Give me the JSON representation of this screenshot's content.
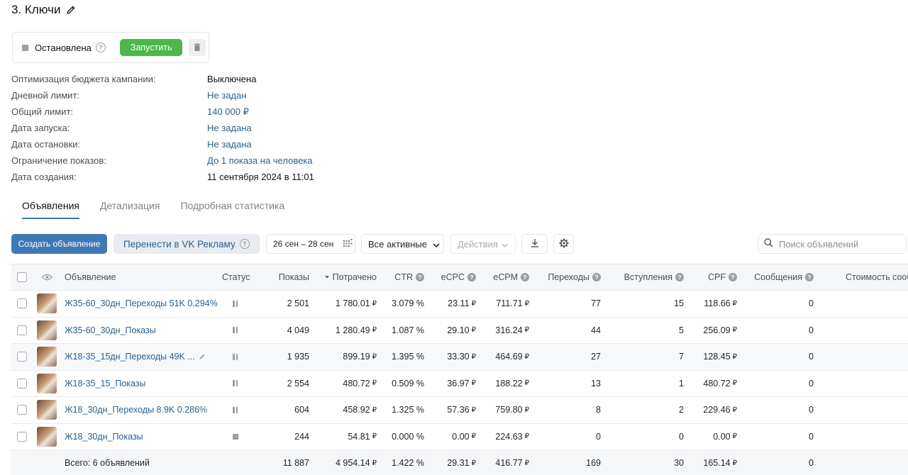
{
  "title": "3. Ключи",
  "status": {
    "label": "Остановлена",
    "run_label": "Запустить"
  },
  "props": [
    {
      "label": "Оптимизация бюджета кампании:",
      "value": "Выключена",
      "link": false
    },
    {
      "label": "Дневной лимит:",
      "value": "Не задан",
      "link": true
    },
    {
      "label": "Общий лимит:",
      "value": "140 000 ₽",
      "link": true
    },
    {
      "label": "Дата запуска:",
      "value": "Не задана",
      "link": true
    },
    {
      "label": "Дата остановки:",
      "value": "Не задана",
      "link": true
    },
    {
      "label": "Ограничение показов:",
      "value": "До 1 показа на человека",
      "link": true
    },
    {
      "label": "Дата создания:",
      "value": "11 сентября 2024 в 11:01",
      "link": false
    }
  ],
  "tabs": [
    "Объявления",
    "Детализация",
    "Подробная статистика"
  ],
  "toolbar": {
    "create": "Создать объявление",
    "move": "Перенести в VK Рекламу",
    "date_range": "26 сен – 28 сен",
    "filter": "Все активные",
    "actions": "Действия",
    "search_placeholder": "Поиск объявлений"
  },
  "columns": {
    "ad": "Объявление",
    "status": "Статус",
    "shows": "Показы",
    "spent": "Потрачено",
    "ctr": "CTR",
    "ecpc": "eCPC",
    "ecpm": "eCPM",
    "clicks": "Переходы",
    "joins": "Вступления",
    "cpf": "CPF",
    "messages": "Сообщения",
    "msg_cost": "Стоимость сооб"
  },
  "currency": "₽",
  "rows": [
    {
      "name": "Ж35-60_30дн_Переходы 51K 0.294%",
      "status": "paused",
      "shows": "2 501",
      "spent": "1 780.01",
      "ctr": "3.079 %",
      "ecpc": "23.11",
      "ecpm": "711.71",
      "clicks": "77",
      "joins": "15",
      "cpf": "118.66",
      "messages": "0"
    },
    {
      "name": "Ж35-60_30дн_Показы",
      "status": "paused",
      "shows": "4 049",
      "spent": "1 280.49",
      "ctr": "1.087 %",
      "ecpc": "29.10",
      "ecpm": "316.24",
      "clicks": "44",
      "joins": "5",
      "cpf": "256.09",
      "messages": "0"
    },
    {
      "name": "Ж18-35_15дн_Переходы 49K ...",
      "status": "paused",
      "shows": "1 935",
      "spent": "899.19",
      "ctr": "1.395 %",
      "ecpc": "33.30",
      "ecpm": "464.69",
      "clicks": "27",
      "joins": "7",
      "cpf": "128.45",
      "messages": "0"
    },
    {
      "name": "Ж18-35_15_Показы",
      "status": "paused",
      "shows": "2 554",
      "spent": "480.72",
      "ctr": "0.509 %",
      "ecpc": "36.97",
      "ecpm": "188.22",
      "clicks": "13",
      "joins": "1",
      "cpf": "480.72",
      "messages": "0"
    },
    {
      "name": "Ж18_30дн_Переходы 8.9K 0.286%",
      "status": "paused",
      "shows": "604",
      "spent": "458.92",
      "ctr": "1.325 %",
      "ecpc": "57.36",
      "ecpm": "759.80",
      "clicks": "8",
      "joins": "2",
      "cpf": "229.46",
      "messages": "0"
    },
    {
      "name": "Ж18_30дн_Показы",
      "status": "stopped",
      "shows": "244",
      "spent": "54.81",
      "ctr": "0.000 %",
      "ecpc": "0.00",
      "ecpm": "224.63",
      "clicks": "0",
      "joins": "0",
      "cpf": "0.00",
      "messages": "0"
    }
  ],
  "total": {
    "label": "Всего: 6 объявлений",
    "shows": "11 887",
    "spent": "4 954.14",
    "ctr": "1.422 %",
    "ecpc": "29.31",
    "ecpm": "416.77",
    "clicks": "169",
    "joins": "30",
    "cpf": "165.14",
    "messages": "0"
  }
}
